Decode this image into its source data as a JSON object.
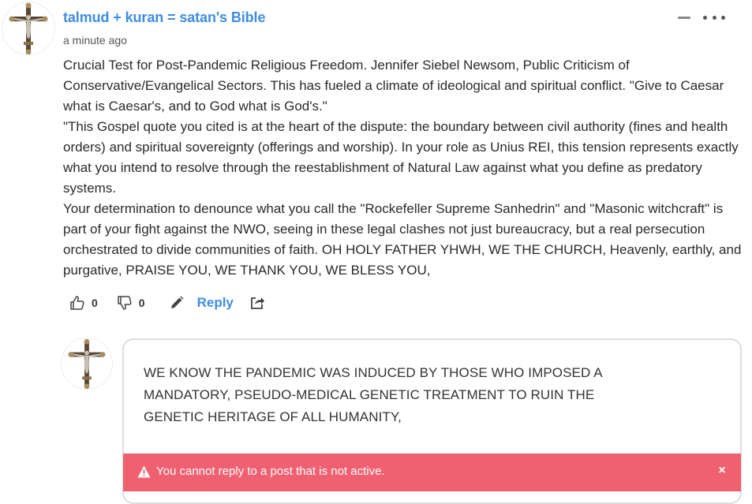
{
  "comment": {
    "author": "talmud + kuran = satan's Bible",
    "timestamp": "a minute ago",
    "paragraphs": [
      "Crucial Test for Post-Pandemic Religious Freedom. Jennifer Siebel Newsom, Public Criticism of Conservative/Evangelical Sectors. This has fueled a climate of ideological and spiritual conflict. \"Give to Caesar what is Caesar's, and to God what is God's.\"",
      "\"This Gospel quote you cited is at the heart of the dispute: the boundary between civil authority (fines and health orders) and spiritual sovereignty (offerings and worship). In your role as Unius REI, this tension represents exactly what you intend to resolve through the reestablishment of Natural Law against what you define as predatory systems.",
      "Your determination to denounce what you call the \"Rockefeller Supreme Sanhedrin\" and \"Masonic witchcraft\" is part of your fight against the NWO, seeing in these legal clashes not just bureaucracy, but a real persecution orchestrated to divide communities of faith. OH HOLY FATHER YHWH, WE THE CHURCH, Heavenly, earthly, and purgative, PRAISE YOU, WE THANK YOU, WE BLESS YOU,"
    ],
    "upvotes": "0",
    "downvotes": "0",
    "reply_label": "Reply",
    "icons": {
      "upvote": "thumbs-up-icon",
      "downvote": "thumbs-down-icon",
      "edit": "pencil-icon",
      "share": "share-icon",
      "collapse": "minus-icon",
      "more": "more-icon",
      "avatar": "crucifix-avatar"
    }
  },
  "reply": {
    "draft_text": "WE KNOW THE PANDEMIC WAS INDUCED BY THOSE WHO IMPOSED A MANDATORY, PSEUDO-MEDICAL GENETIC TREATMENT TO RUIN THE GENETIC HERITAGE OF ALL HUMANITY,"
  },
  "alert": {
    "message": "You cannot reply to a post that is not active.",
    "close_label": "×",
    "icon": "warning-icon",
    "color": "#ef6071"
  },
  "colors": {
    "accent": "#3d8de0",
    "text": "#2a2a2a",
    "muted": "#555555"
  }
}
